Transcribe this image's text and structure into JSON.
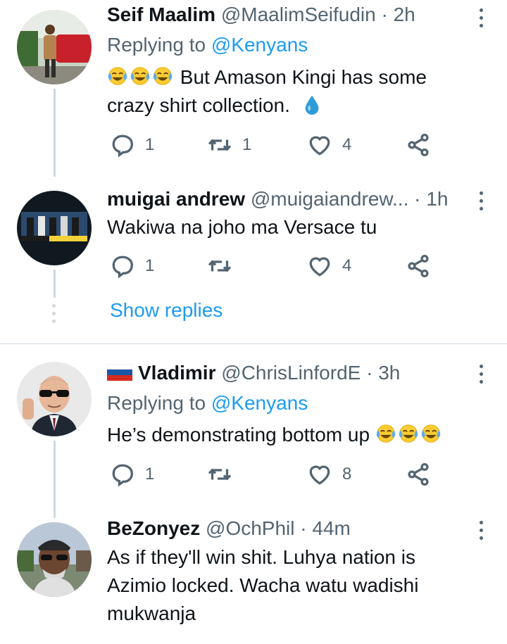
{
  "tweets": [
    {
      "name": "Seif Maalim",
      "handle": "@MaalimSeifudin",
      "dot": "·",
      "time": "2h",
      "replying_prefix": "Replying to",
      "replying_to": "@Kenyans",
      "text_line1": "But Amason Kingi has some",
      "text_line2": "crazy shirt collection.",
      "emojis": [
        "face-with-tears-of-joy",
        "face-with-tears-of-joy",
        "face-with-tears-of-joy",
        "droplet"
      ],
      "replies": "1",
      "retweets": "1",
      "likes": "4"
    },
    {
      "name": "muigai andrew",
      "handle": "@muigaiandrew...",
      "dot": "·",
      "time": "1h",
      "text_line1": "Wakiwa na joho ma Versace tu",
      "replies": "1",
      "retweets": "",
      "likes": "4"
    },
    {
      "name": "Vladimir",
      "handle": "@ChrisLinfordE",
      "dot": "·",
      "time": "3h",
      "flag": "russia-flag",
      "replying_prefix": "Replying to",
      "replying_to": "@Kenyans",
      "text_line1": "He’s demonstrating bottom up",
      "emojis": [
        "face-with-tears-of-joy",
        "face-with-tears-of-joy",
        "face-with-tears-of-joy"
      ],
      "replies": "1",
      "retweets": "",
      "likes": "8"
    },
    {
      "name": "BeZonyez",
      "handle": "@OchPhil",
      "dot": "·",
      "time": "44m",
      "text_line1": "As if they'll win shit. Luhya nation is",
      "text_line2": "Azimio locked. Wacha watu wadishi",
      "text_line3": "mukwanja"
    }
  ],
  "show_replies": "Show replies",
  "icons": [
    "reply-icon",
    "retweet-icon",
    "like-icon",
    "share-icon",
    "more-options-icon"
  ],
  "colors": {
    "link": "#1d9bf0",
    "secondary": "#536471",
    "line": "#cfd9de"
  }
}
